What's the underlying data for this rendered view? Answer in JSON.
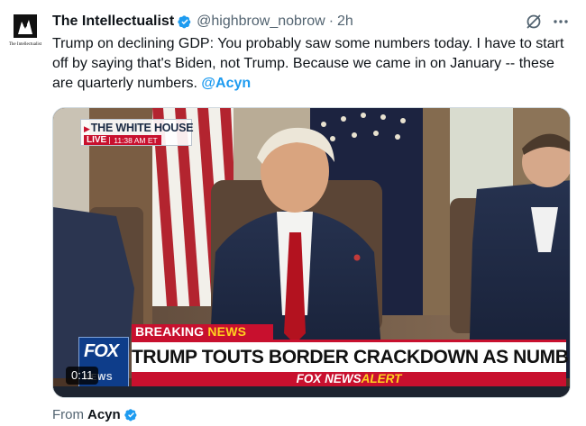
{
  "tweet": {
    "author": {
      "name": "The Intellectualist",
      "handle": "@highbrow_nobrow",
      "avatar_label": "The Intellectualist",
      "verified": true,
      "verified_icon": "verified-badge-icon"
    },
    "separator": "·",
    "time": "2h",
    "actions": {
      "grok_icon": "grok-slash-icon",
      "more_icon": "more-dots-icon"
    },
    "text": "Trump on declining GDP: You probably saw some numbers today. I have to start off by saying that's Biden, not Trump. Because we came in on January -- these are quarterly numbers.",
    "mention": "@Acyn",
    "media": {
      "type": "video",
      "duration": "0:11",
      "overlay": {
        "network_bug_title": "THE WHITE HOUSE",
        "live_label": "LIVE",
        "live_time": "11:38 AM ET",
        "breaking_label_1": "BREAKING",
        "breaking_label_2": "NEWS",
        "headline": "TRUMP TOUTS BORDER CRACKDOWN AS NUMBERS PLUNGE",
        "alert_label_1": "FOX NEWS",
        "alert_label_2": "ALERT",
        "logo_text": "FOX",
        "logo_sub": "NEWS"
      }
    },
    "source": {
      "prefix": "From",
      "name": "Acyn",
      "verified": true
    }
  },
  "colors": {
    "accent": "#1d9bf0",
    "text_primary": "#0f1419",
    "text_secondary": "#536471",
    "fox_red": "#c8102e",
    "fox_yellow": "#ffd21f",
    "fox_blue": "#0e3d8a"
  }
}
